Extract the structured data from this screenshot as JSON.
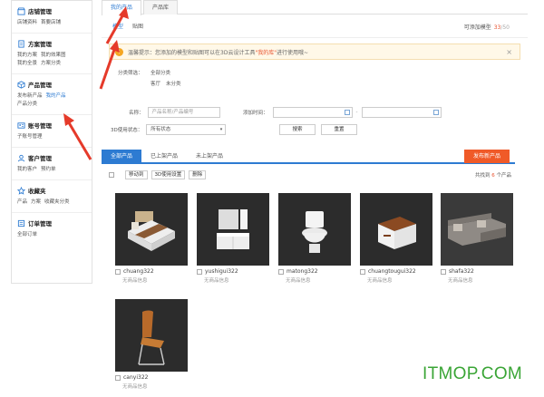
{
  "sidebar": {
    "sections": [
      {
        "title": "店铺管理",
        "icon": "store-icon",
        "links": [
          "店铺资料",
          "首要店铺"
        ],
        "active": -1
      },
      {
        "title": "方案管理",
        "icon": "document-icon",
        "links": [
          "我的方案",
          "我的效果图",
          "我的全景",
          "方案分类"
        ],
        "active": -1
      },
      {
        "title": "产品管理",
        "icon": "cube-icon",
        "links": [
          "发布新产品",
          "我的产品",
          "产品分类"
        ],
        "active": 1
      },
      {
        "title": "账号管理",
        "icon": "account-icon",
        "links": [
          "子账号管理"
        ],
        "active": -1
      },
      {
        "title": "客户管理",
        "icon": "customer-icon",
        "links": [
          "我的客户",
          "预约单"
        ],
        "active": -1
      },
      {
        "title": "收藏夹",
        "icon": "star-icon",
        "links": [
          "产品",
          "方案",
          "收藏夹分类"
        ],
        "active": -1
      },
      {
        "title": "订单管理",
        "icon": "order-icon",
        "links": [
          "全部订单"
        ],
        "active": -1
      }
    ]
  },
  "tabs": [
    "我的产品",
    "产品库"
  ],
  "subtabs": [
    "模型",
    "贴图"
  ],
  "quota": {
    "label": "可添加模型",
    "used": "33",
    "total": "/50"
  },
  "notice": {
    "prefix": "温馨提示：您添加的模型和贴图可以在3D云设计工具",
    "highlight": "\"我的库\"",
    "suffix": "进行使用哦~"
  },
  "filter": {
    "label": "分类筛选：",
    "row1": [
      "全部分类"
    ],
    "row2": [
      "客厅",
      "未分类"
    ]
  },
  "form": {
    "name_label": "名称：",
    "name_placeholder": "产品名称/产品编号",
    "time_label": "添加时间：",
    "status_label": "3D使用状态：",
    "status_value": "所有状态",
    "search_btn": "搜索",
    "reset_btn": "重置"
  },
  "list_tabs": [
    "全部产品",
    "已上架产品",
    "未上架产品"
  ],
  "publish_btn": "发布新产品",
  "toolbar": {
    "buttons": [
      "移动到",
      "3D使用设置",
      "删除"
    ],
    "found_prefix": "共找到",
    "found_count": "6",
    "found_suffix": "个产品"
  },
  "products": [
    {
      "name": "chuang322",
      "info": "无商品信息",
      "thumb": "bed"
    },
    {
      "name": "yushigui322",
      "info": "无商品信息",
      "thumb": "bathroom-cabinet"
    },
    {
      "name": "matong322",
      "info": "无商品信息",
      "thumb": "toilet"
    },
    {
      "name": "chuangtougui322",
      "info": "无商品信息",
      "thumb": "nightstand"
    },
    {
      "name": "shafa322",
      "info": "无商品信息",
      "thumb": "sofa"
    },
    {
      "name": "canyi322",
      "info": "无商品信息",
      "thumb": "chair"
    }
  ],
  "watermark": "ITMOP.COM",
  "colors": {
    "accent": "#2d7bd2",
    "publish": "#f05a28",
    "highlight": "#e8512d",
    "watermark": "#3aa536"
  }
}
